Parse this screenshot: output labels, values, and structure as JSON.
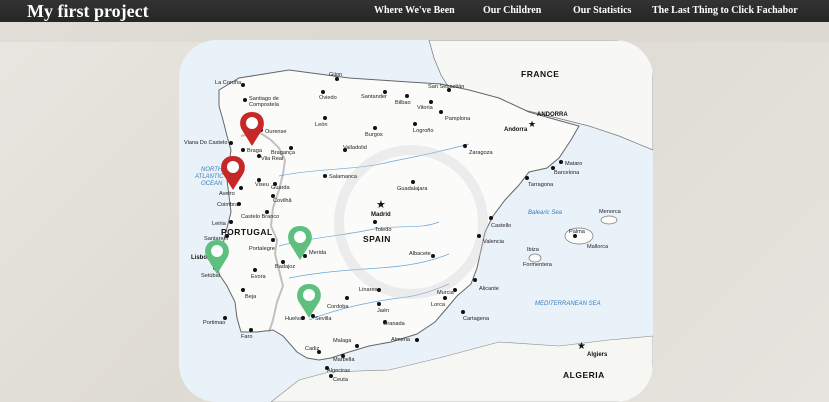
{
  "app": {
    "title": "My first project"
  },
  "nav": [
    {
      "label": "Where We've Been"
    },
    {
      "label": "Our Children"
    },
    {
      "label": "Our Statistics"
    },
    {
      "label": "The Last Thing to Click Fachabor"
    }
  ],
  "map": {
    "countries": {
      "france": "FRANCE",
      "andorra": "ANDORRA",
      "portugal": "PORTUGAL",
      "spain": "SPAIN",
      "algeria": "ALGERIA"
    },
    "seas": {
      "atlantic_1": "NORTH",
      "atlantic_2": "ATLANTIC",
      "atlantic_3": "OCEAN",
      "balearic": "Balearic Sea",
      "mediterranean": "MEDITERRANEAN SEA"
    },
    "capitals": {
      "madrid": "Madrid",
      "lisbon": "Lisboa",
      "andorra_la_vella": "Andorra",
      "algiers": "Algiers"
    },
    "cities": {
      "la_coruna": "La Coruña",
      "santiago": "Santiago de",
      "compostela": "Compostela",
      "gijon": "Gijon",
      "oviedo": "Oviedo",
      "santander": "Santander",
      "san_sebastian": "San Sebastián",
      "bilbao": "Bilbao",
      "vitoria": "Vitoria",
      "pamplona": "Pamplona",
      "leon": "León",
      "burgos": "Burgos",
      "logrono": "Logroño",
      "zaragoza": "Zaragoza",
      "ourense": "Ourense",
      "viana": "Viana Do Castelo",
      "braga": "Braga",
      "braganca": "Bragança",
      "vila_real": "Vila Real",
      "valladolid": "Valladolid",
      "mataro": "Mataro",
      "barcelona": "Barcelona",
      "tarragona": "Tarragona",
      "salamanca": "Salamanca",
      "aveiro": "Aveiro",
      "viseu": "Viseu",
      "guarda": "Guarda",
      "covilha": "Covilhã",
      "coimbra": "Coimbra",
      "guadalajara": "Guadalajara",
      "castelo_branco": "Castelo Branco",
      "leiria": "Leiria",
      "santarem": "Santarem",
      "portalegre": "Portalegre",
      "toledo": "Toledo",
      "castello": "Castello",
      "valencia": "Valencia",
      "merida": "Merida",
      "badajoz": "Badajoz",
      "albacete": "Albacete",
      "setubal": "Setúbal",
      "evora": "Evora",
      "beja": "Beja",
      "linares": "Linares",
      "murcia": "Murcia",
      "alicante": "Alicante",
      "lorca": "Lorca",
      "cartagena": "Cartagena",
      "cordoba": "Cordoba",
      "jaen": "Jaén",
      "huelva": "Huelva",
      "sevilla": "Sevilla",
      "granada": "Granada",
      "almeria": "Almeria",
      "portimao": "Portimao",
      "faro": "Faro",
      "cadiz": "Cadiz",
      "malaga": "Malaga",
      "marbella": "Marbella",
      "algeciras": "Algeciras",
      "ceuta": "Ceuta",
      "menorca": "Menorca",
      "palma": "Palma",
      "mallorca": "Mallorca",
      "ibiza": "Ibiza",
      "formentera": "Formentera"
    },
    "pins": [
      {
        "name": "pin-ourense",
        "color": "#c62828"
      },
      {
        "name": "pin-aveiro",
        "color": "#c62828"
      },
      {
        "name": "pin-lisboa",
        "color": "#5fbf7e"
      },
      {
        "name": "pin-merida",
        "color": "#5fbf7e"
      },
      {
        "name": "pin-sevilla",
        "color": "#5fbf7e"
      }
    ]
  }
}
